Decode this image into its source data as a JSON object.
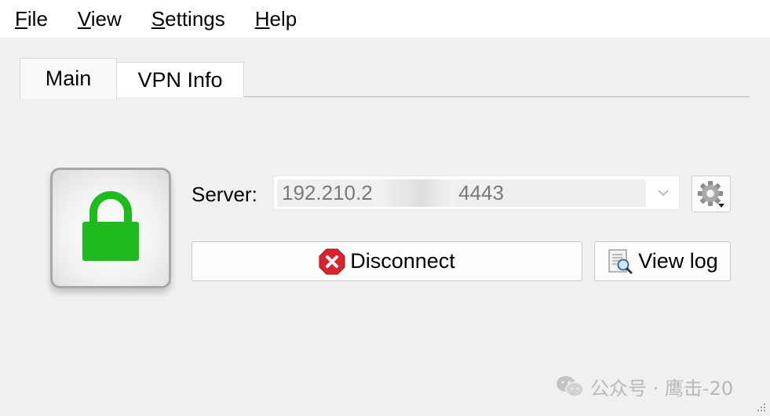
{
  "menubar": {
    "items": [
      {
        "label": "File",
        "accel": "F",
        "rest": "ile"
      },
      {
        "label": "View",
        "accel": "V",
        "rest": "iew"
      },
      {
        "label": "Settings",
        "accel": "S",
        "rest": "ettings"
      },
      {
        "label": "Help",
        "accel": "H",
        "rest": "elp"
      }
    ]
  },
  "tabs": [
    {
      "label": "Main",
      "active": true
    },
    {
      "label": "VPN Info",
      "active": false
    }
  ],
  "status": {
    "icon": "lock-closed-icon",
    "color": "#1dbb1d"
  },
  "server": {
    "label": "Server:",
    "value_prefix": "192.210.2",
    "value_suffix": "4443"
  },
  "buttons": {
    "disconnect": {
      "label": "Disconnect",
      "icon": "disconnect-icon",
      "icon_color": "#d9232e"
    },
    "view_log": {
      "label": "View log",
      "icon": "log-magnifier-icon"
    },
    "settings": {
      "icon": "gear-icon"
    }
  },
  "watermark": {
    "text": "公众号 · 鹰击-20",
    "icon": "wechat-icon"
  }
}
